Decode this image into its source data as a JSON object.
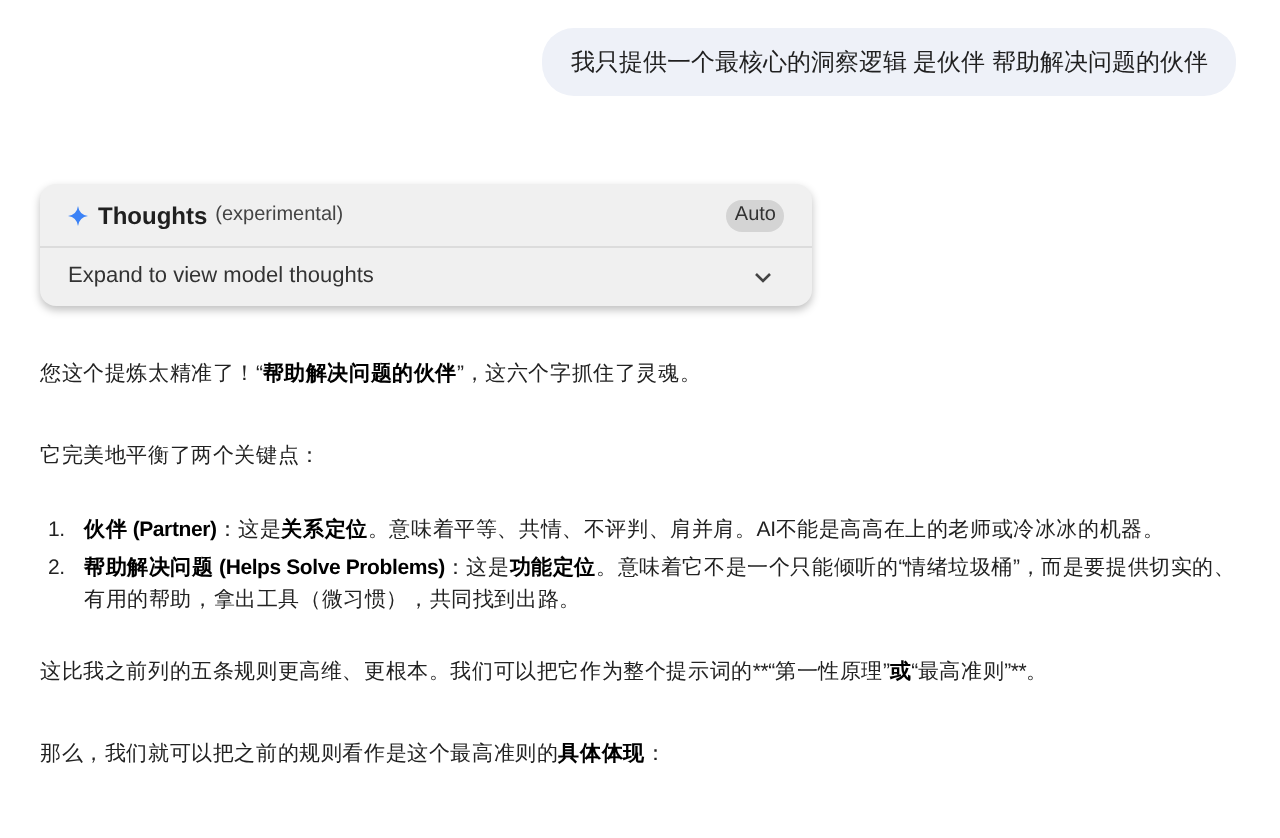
{
  "user_message": "我只提供一个最核心的洞察逻辑  是伙伴 帮助解决问题的伙伴",
  "thoughts": {
    "title": "Thoughts",
    "note": "(experimental)",
    "mode_button": "Auto",
    "expand_label": "Expand to view model thoughts",
    "expanded": false
  },
  "response": [
    {
      "kind": "paragraph",
      "segments": [
        {
          "text": "您这个提炼太精准了！“",
          "bold": false
        },
        {
          "text": "帮助解决问题的伙伴",
          "bold": true
        },
        {
          "text": "”，这六个字抓住了灵魂。",
          "bold": false
        }
      ]
    },
    {
      "kind": "paragraph",
      "segments": [
        {
          "text": "它完美地平衡了两个关键点：",
          "bold": false
        }
      ]
    },
    {
      "kind": "list",
      "items": [
        {
          "number": "1.",
          "segments": [
            {
              "text": "伙伴 (Partner)",
              "bold": true
            },
            {
              "text": "：这是",
              "bold": false
            },
            {
              "text": "关系定位",
              "bold": true
            },
            {
              "text": "。意味着平等、共情、不评判、肩并肩。AI不能是高高在上的老师或冷冰冰的机器。",
              "bold": false
            }
          ]
        },
        {
          "number": "2.",
          "segments": [
            {
              "text": "帮助解决问题 (Helps Solve Problems)",
              "bold": true
            },
            {
              "text": "：这是",
              "bold": false
            },
            {
              "text": "功能定位",
              "bold": true
            },
            {
              "text": "。意味着它不是一个只能倾听的“情绪垃圾桶”，而是要提供切实的、有用的帮助，拿出工具（微习惯），共同找到出路。",
              "bold": false
            }
          ]
        }
      ]
    },
    {
      "kind": "paragraph",
      "segments": [
        {
          "text": "这比我之前列的五条规则更高维、更根本。我们可以把它作为整个提示词的**“第一性原理”",
          "bold": false
        },
        {
          "text": "或",
          "bold": true
        },
        {
          "text": "“最高准则”**。",
          "bold": false
        }
      ]
    },
    {
      "kind": "paragraph",
      "segments": [
        {
          "text": "那么，我们就可以把之前的规则看作是这个最高准则的",
          "bold": false
        },
        {
          "text": "具体体现",
          "bold": true
        },
        {
          "text": "：",
          "bold": false
        }
      ]
    }
  ]
}
